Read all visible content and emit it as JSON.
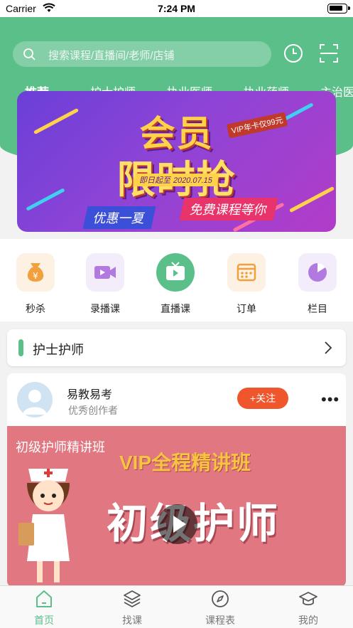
{
  "status_bar": {
    "carrier": "Carrier",
    "time": "7:24 PM"
  },
  "search": {
    "placeholder": "搜索课程/直播间/老师/店铺"
  },
  "category_tabs": [
    {
      "label": "推荐",
      "active": true
    },
    {
      "label": "护士护师",
      "active": false
    },
    {
      "label": "执业医师",
      "active": false
    },
    {
      "label": "执业药师",
      "active": false
    },
    {
      "label": "主治医",
      "active": false
    }
  ],
  "banner": {
    "title_line1": "会员",
    "title_line2": "限时抢",
    "vip_tag": "VIP年卡仅99元",
    "date_text": "即日起至 2020.07.15",
    "tag_left": "优惠一夏",
    "tag_right": "免费课程等你"
  },
  "quick_menu": [
    {
      "label": "秒杀",
      "icon": "money-bag-icon"
    },
    {
      "label": "录播课",
      "icon": "video-camera-icon"
    },
    {
      "label": "直播课",
      "icon": "tv-play-icon"
    },
    {
      "label": "订单",
      "icon": "calendar-icon"
    },
    {
      "label": "栏目",
      "icon": "pie-chart-icon"
    }
  ],
  "section": {
    "label": "护士护师"
  },
  "post": {
    "author": "易教易考",
    "author_subtitle": "优秀创作者",
    "follow_label": "+关注",
    "cover_text1": "初级护师精讲班",
    "cover_text2": "VIP全程精讲班",
    "cover_text3": "初级护师"
  },
  "tab_bar": [
    {
      "label": "首页",
      "icon": "home-icon",
      "active": true
    },
    {
      "label": "找课",
      "icon": "layers-icon",
      "active": false
    },
    {
      "label": "课程表",
      "icon": "compass-icon",
      "active": false
    },
    {
      "label": "我的",
      "icon": "graduation-cap-icon",
      "active": false
    }
  ],
  "colors": {
    "brand_green": "#5bbf8a",
    "follow_red": "#f0562c",
    "cover_pink": "#e07781"
  }
}
